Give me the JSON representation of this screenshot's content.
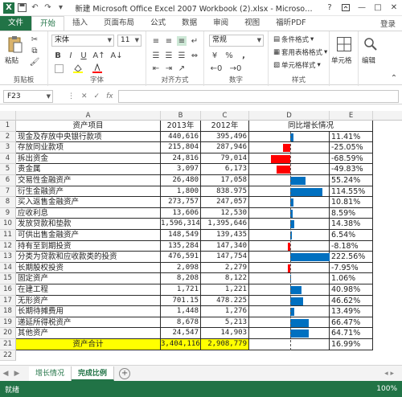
{
  "window": {
    "title": "新建 Microsoft Office Excel 2007 Workbook (2).xlsx - Microso…",
    "help": "?",
    "min": "—",
    "max": "□",
    "close": "✕"
  },
  "ribbon_tabs": [
    "文件",
    "开始",
    "插入",
    "页面布局",
    "公式",
    "数据",
    "审阅",
    "视图",
    "福昕PDF"
  ],
  "login": "登录",
  "ribbon": {
    "paste": "粘贴",
    "clipboard": "剪贴板",
    "font_name": "宋体",
    "font_size": "11",
    "font_group": "字体",
    "align_group": "对齐方式",
    "number_format": "常规",
    "number_group": "数字",
    "cond_format": "条件格式",
    "table_format": "套用表格格式",
    "cell_style": "单元格样式",
    "styles_group": "样式",
    "cells": "单元格",
    "edit": "编辑",
    "bold": "B",
    "italic": "I",
    "underline": "U",
    "percent": "%",
    "comma": ","
  },
  "name_box": "F23",
  "fx": "fx",
  "columns": [
    "A",
    "B",
    "C",
    "D",
    "E"
  ],
  "rows": [
    "1",
    "2",
    "3",
    "4",
    "5",
    "6",
    "7",
    "8",
    "9",
    "10",
    "11",
    "12",
    "13",
    "14",
    "15",
    "16",
    "17",
    "18",
    "19",
    "20",
    "21",
    "22"
  ],
  "table_header": {
    "item": "资产项目",
    "y2013": "2013年",
    "y2012": "2012年",
    "chart": "同比增长情况"
  },
  "items": [
    {
      "name": "现金及存放中央银行款项",
      "y2013": "440,616",
      "y2012": "395,496",
      "growth": "11.41%",
      "g": 11.41
    },
    {
      "name": "存放同业款项",
      "y2013": "215,804",
      "y2012": "287,946",
      "growth": "-25.05%",
      "g": -25.05
    },
    {
      "name": "拆出资金",
      "y2013": "24,816",
      "y2012": "79,014",
      "growth": "-68.59%",
      "g": -68.59
    },
    {
      "name": "贵金属",
      "y2013": "3,097",
      "y2012": "6,173",
      "growth": "-49.83%",
      "g": -49.83
    },
    {
      "name": "交易性金融资产",
      "y2013": "26,480",
      "y2012": "17,058",
      "growth": "55.24%",
      "g": 55.24
    },
    {
      "name": "衍生金融资产",
      "y2013": "1,800",
      "y2012": "838.975",
      "growth": "114.55%",
      "g": 114.55
    },
    {
      "name": "买入返售金融资产",
      "y2013": "273,757",
      "y2012": "247,057",
      "growth": "10.81%",
      "g": 10.81
    },
    {
      "name": "应收利息",
      "y2013": "13,606",
      "y2012": "12,530",
      "growth": "8.59%",
      "g": 8.59
    },
    {
      "name": "发放贷款和垫款",
      "y2013": "1,596,314",
      "y2012": "1,395,646",
      "growth": "14.38%",
      "g": 14.38
    },
    {
      "name": "可供出售金融资产",
      "y2013": "148,549",
      "y2012": "139,435",
      "growth": "6.54%",
      "g": 6.54
    },
    {
      "name": "持有至到期投资",
      "y2013": "135,284",
      "y2012": "147,340",
      "growth": "-8.18%",
      "g": -8.18
    },
    {
      "name": "分类为贷款和应收款类的投资",
      "y2013": "476,591",
      "y2012": "147,754",
      "growth": "222.56%",
      "g": 222.56
    },
    {
      "name": "长期股权投资",
      "y2013": "2,098",
      "y2012": "2,279",
      "growth": "-7.95%",
      "g": -7.95
    },
    {
      "name": "固定资产",
      "y2013": "8,208",
      "y2012": "8,122",
      "growth": "1.06%",
      "g": 1.06
    },
    {
      "name": "在建工程",
      "y2013": "1,721",
      "y2012": "1,221",
      "growth": "40.98%",
      "g": 40.98
    },
    {
      "name": "无形资产",
      "y2013": "701.15",
      "y2012": "478.225",
      "growth": "46.62%",
      "g": 46.62
    },
    {
      "name": "长期待摊费用",
      "y2013": "1,448",
      "y2012": "1,276",
      "growth": "13.49%",
      "g": 13.49
    },
    {
      "name": "递延所得税资产",
      "y2013": "8,678",
      "y2012": "5,213",
      "growth": "66.47%",
      "g": 66.47
    },
    {
      "name": "其他资产",
      "y2013": "24,547",
      "y2012": "14,903",
      "growth": "64.71%",
      "g": 64.71
    }
  ],
  "total": {
    "name": "资产合计",
    "y2013": "3,404,116",
    "y2012": "2,908,779",
    "growth": "16.99%"
  },
  "colors": {
    "positive": "#0070c0",
    "negative": "#ff0000",
    "brand": "#217346",
    "highlight": "#ffff00"
  },
  "sheets": [
    "增长情况",
    "完成比例"
  ],
  "active_sheet": 1,
  "add_sheet": "+",
  "status": {
    "ready": "就绪",
    "zoom": "100%"
  }
}
